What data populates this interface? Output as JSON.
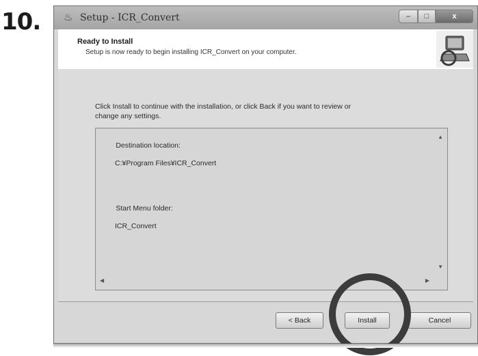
{
  "step": {
    "number": "10."
  },
  "window": {
    "title": "Setup - ICR_Convert",
    "controls": {
      "minimize": "–",
      "maximize": "□",
      "close": "x"
    }
  },
  "header": {
    "title": "Ready to Install",
    "subtitle": "Setup is now ready to begin installing ICR_Convert on your computer."
  },
  "main": {
    "instruction_line1": "Click Install to continue with the installation, or click Back if you want to review or",
    "instruction_line2": "change any settings.",
    "memo": {
      "dest_label": "Destination location:",
      "dest_value": "C:¥Program Files¥ICR_Convert",
      "start_label": "Start Menu folder:",
      "start_value": "ICR_Convert"
    }
  },
  "buttons": {
    "back": "< Back",
    "install": "Install",
    "cancel": "Cancel"
  },
  "colors": {
    "dialog_bg": "#dcdcdc",
    "highlight_ring": "#3c3c3c"
  },
  "icons": {
    "app": "setup-app-icon",
    "logo": "computer-install-icon"
  }
}
